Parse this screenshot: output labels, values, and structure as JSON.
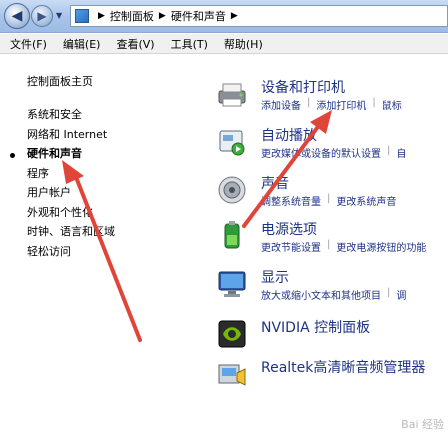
{
  "address": {
    "crumbs": [
      "控制面板",
      "硬件和声音"
    ]
  },
  "menu": [
    "文件(F)",
    "编辑(E)",
    "查看(V)",
    "工具(T)",
    "帮助(H)"
  ],
  "sidebar": {
    "home": "控制面板主页",
    "items": [
      {
        "label": "系统和安全"
      },
      {
        "label": "网络和 Internet"
      },
      {
        "label": "硬件和声音",
        "current": true
      },
      {
        "label": "程序"
      },
      {
        "label": "用户帐户"
      },
      {
        "label": "外观和个性化"
      },
      {
        "label": "时钟、语言和区域"
      },
      {
        "label": "轻松访问"
      }
    ]
  },
  "categories": [
    {
      "title": "设备和打印机",
      "links": [
        "添加设备",
        "添加打印机",
        "鼠标"
      ],
      "icon": "printer-icon"
    },
    {
      "title": "自动播放",
      "links": [
        "更改媒体或设备的默认设置",
        "自"
      ],
      "icon": "autoplay-icon"
    },
    {
      "title": "声音",
      "links": [
        "调整系统音量",
        "更改系统声音"
      ],
      "icon": "speaker-icon"
    },
    {
      "title": "电源选项",
      "links": [
        "更改节能设置",
        "更改电源按钮的功能"
      ],
      "icon": "power-icon"
    },
    {
      "title": "显示",
      "links": [
        "放大或缩小文本和其他项目",
        "调"
      ],
      "icon": "monitor-icon"
    },
    {
      "title": "NVIDIA 控制面板",
      "links": [],
      "icon": "nvidia-icon"
    },
    {
      "title": "Realtek高清晰音频管理器",
      "links": [],
      "icon": "realtek-icon"
    }
  ],
  "colors": {
    "link": "#1e3287",
    "arrow": "#e0453a"
  },
  "watermark": "Bai 经验"
}
